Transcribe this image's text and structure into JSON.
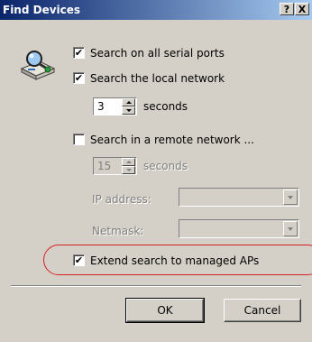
{
  "window": {
    "title": "Find Devices",
    "help_glyph": "?",
    "close_glyph": "X"
  },
  "options": {
    "serial_ports": {
      "label": "Search on all serial ports",
      "checked": true
    },
    "local_network": {
      "label": "Search the local network",
      "checked": true,
      "timeout_value": "3",
      "timeout_unit": "seconds"
    },
    "remote_network": {
      "label": "Search in a remote network ...",
      "checked": false,
      "timeout_value": "15",
      "timeout_unit": "seconds",
      "ip_label": "IP address:",
      "ip_value": "",
      "netmask_label": "Netmask:",
      "netmask_value": ""
    },
    "managed_aps": {
      "label": "Extend search to managed APs",
      "checked": true
    }
  },
  "check_glyph": "✔",
  "buttons": {
    "ok": "OK",
    "cancel": "Cancel"
  },
  "colors": {
    "dialog_bg": "#d4d0c8",
    "title_start": "#0a246a",
    "title_end": "#a6caf0",
    "highlight": "#d62020"
  },
  "icons": {
    "dialog_icon": "network-computer-search-icon"
  }
}
